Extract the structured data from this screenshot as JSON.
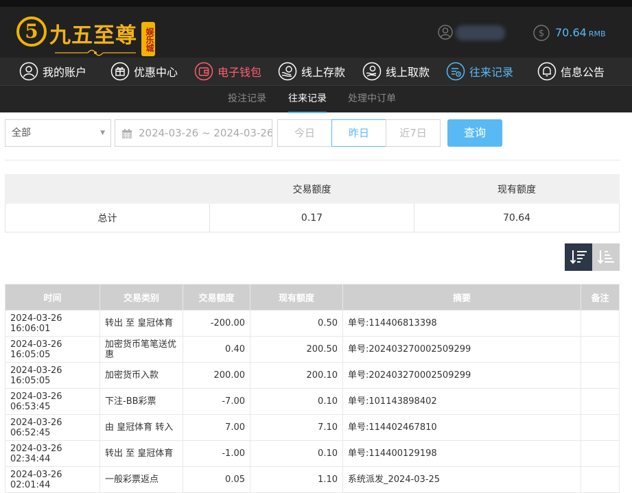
{
  "brand": {
    "name": "九五至尊",
    "badge": "娱乐城",
    "ring_glyph": "5"
  },
  "account": {
    "balance": "70.64",
    "currency": "RMB"
  },
  "nav": [
    {
      "label": "我的账户",
      "icon": "user-circle-icon"
    },
    {
      "label": "优惠中心",
      "icon": "gift-icon"
    },
    {
      "label": "电子钱包",
      "icon": "wallet-icon"
    },
    {
      "label": "线上存款",
      "icon": "deposit-icon"
    },
    {
      "label": "线上取款",
      "icon": "withdraw-icon"
    },
    {
      "label": "往来记录",
      "icon": "records-icon"
    },
    {
      "label": "信息公告",
      "icon": "bell-icon"
    }
  ],
  "subnav": [
    "投注记录",
    "往来记录",
    "处理中订单"
  ],
  "filters": {
    "type_select": "全部",
    "date_range": "2024-03-26 ~ 2024-03-26",
    "quick": [
      "今日",
      "昨日",
      "近7日"
    ],
    "query_label": "查询"
  },
  "summary": {
    "headers": [
      "",
      "交易额度",
      "现有额度"
    ],
    "row": [
      "总计",
      "0.17",
      "70.64"
    ]
  },
  "records": {
    "headers": [
      "时间",
      "交易类别",
      "交易额度",
      "现有额度",
      "摘要",
      "备注"
    ],
    "rows": [
      [
        "2024-03-26 16:06:01",
        "转出 至 皇冠体育",
        "-200.00",
        "0.50",
        "单号:114406813398",
        ""
      ],
      [
        "2024-03-26 16:05:05",
        "加密货币笔笔送优惠",
        "0.40",
        "200.50",
        "单号:202403270002509299",
        ""
      ],
      [
        "2024-03-26 16:05:05",
        "加密货币入款",
        "200.00",
        "200.10",
        "单号:202403270002509299",
        ""
      ],
      [
        "2024-03-26 06:53:45",
        "下注-BB彩票",
        "-7.00",
        "0.10",
        "单号:101143898402",
        ""
      ],
      [
        "2024-03-26 06:52:45",
        "由 皇冠体育 转入",
        "7.00",
        "7.10",
        "单号:114402467810",
        ""
      ],
      [
        "2024-03-26 02:34:44",
        "转出 至 皇冠体育",
        "-1.00",
        "0.10",
        "单号:114400129198",
        ""
      ],
      [
        "2024-03-26 02:01:44",
        "一般彩票返点",
        "0.05",
        "1.10",
        "系统派发_2024-03-25",
        ""
      ]
    ]
  },
  "colors": {
    "accent": "#59b9f5",
    "gold": "#f2b21a",
    "wallet_red": "#ff5f6d",
    "header_bg": "#212121"
  }
}
